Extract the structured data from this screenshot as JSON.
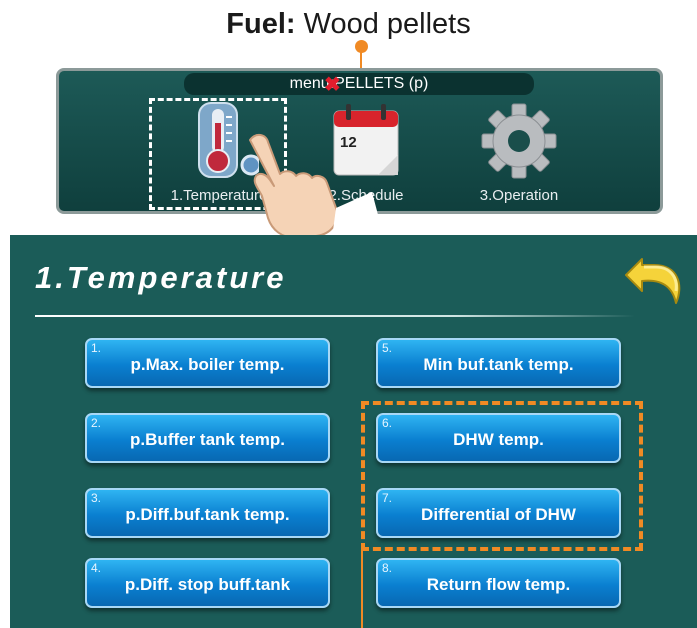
{
  "fuel": {
    "label": "Fuel:",
    "value": "Wood pellets"
  },
  "menu": {
    "title": "menu:PELLETS (p)",
    "close_glyph": "✖",
    "items": [
      {
        "label": "1.Temperature",
        "icon": "thermometer-icon"
      },
      {
        "label": "2.Schedule",
        "icon": "calendar-icon",
        "calendar_day": "12"
      },
      {
        "label": "3.Operation",
        "icon": "gear-icon"
      }
    ]
  },
  "screen": {
    "title": "1.Temperature",
    "back_icon": "back-arrow-icon",
    "buttons": [
      {
        "num": "1.",
        "label": "p.Max. boiler temp."
      },
      {
        "num": "2.",
        "label": "p.Buffer tank temp."
      },
      {
        "num": "3.",
        "label": "p.Diff.buf.tank temp."
      },
      {
        "num": "4.",
        "label": "p.Diff. stop buff.tank"
      },
      {
        "num": "5.",
        "label": "Min buf.tank temp."
      },
      {
        "num": "6.",
        "label": "DHW temp."
      },
      {
        "num": "7.",
        "label": "Differential of DHW"
      },
      {
        "num": "8.",
        "label": "Return flow temp."
      }
    ]
  },
  "colors": {
    "accent": "#f08a24",
    "panel": "#1b5c58",
    "button": "#0a7fd0"
  }
}
